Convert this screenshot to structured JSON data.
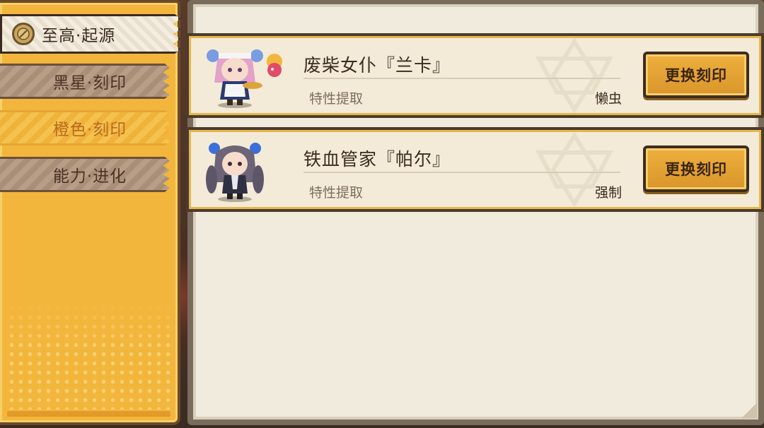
{
  "sidebar": {
    "tabs": [
      {
        "label": "至高·起源",
        "state": "selected",
        "icon": "coin-icon"
      },
      {
        "label": "黑星·刻印",
        "state": "normal"
      },
      {
        "label": "橙色·刻印",
        "state": "highlighted"
      },
      {
        "label": "能力·进化",
        "state": "normal"
      }
    ]
  },
  "engravings": [
    {
      "name": "废柴女仆『兰卡』",
      "trait_label": "特性提取",
      "trait_value": "懒虫",
      "button_label": "更换刻印",
      "portrait": "maid-character-portrait"
    },
    {
      "name": "铁血管家『帕尔』",
      "trait_label": "特性提取",
      "trait_value": "强制",
      "button_label": "更换刻印",
      "portrait": "butler-character-portrait"
    }
  ],
  "colors": {
    "accent_gold": "#f2b63c",
    "panel_bg": "#f1ebde",
    "button_gold": "#e4a536",
    "tab_brown": "#b89d87",
    "text_dark": "#3a2b20",
    "text_muted": "#7d6d5f",
    "tab_orange_text": "#b86a1f"
  }
}
